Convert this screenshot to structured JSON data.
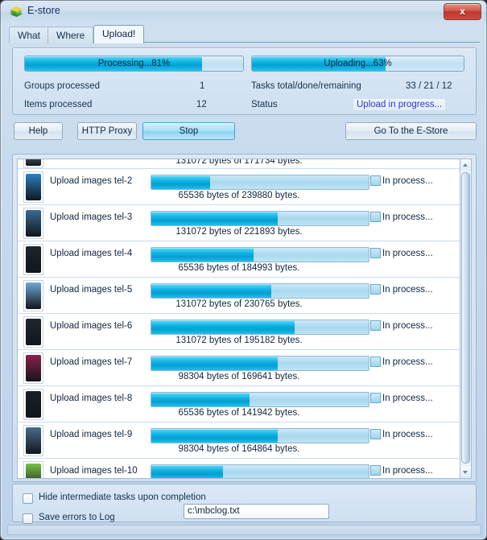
{
  "window": {
    "title": "E-store",
    "icon": "estore-books-icon",
    "close_label": "x"
  },
  "tabs": [
    {
      "label": "What",
      "active": false
    },
    {
      "label": "Where",
      "active": false
    },
    {
      "label": "Upload!",
      "active": true
    }
  ],
  "stats": {
    "processing_bar": {
      "label": "Processing...81%",
      "percent": 81
    },
    "uploading_bar": {
      "label": "Uploading...63%",
      "percent": 63
    },
    "rows": [
      {
        "label": "Groups processed",
        "value": "1"
      },
      {
        "label": "Items processed",
        "value": "12"
      }
    ],
    "tasks_label": "Tasks total/done/remaining",
    "tasks_value": "33 / 21 / 12",
    "status_label": "Status",
    "status_value": "Upload in progress...",
    "status_color": "#2a38d0"
  },
  "buttons": {
    "help": "Help",
    "http_proxy": "HTTP Proxy",
    "stop": "Stop",
    "go_to_store": "Go To the E-Store"
  },
  "tasks": [
    {
      "name": "",
      "percent": 0,
      "state": "",
      "bytes": "131072 bytes of 171734 bytes.",
      "clipped": true,
      "thumb": "#b9c7d3"
    },
    {
      "name": "Upload images tel-2",
      "percent": 27,
      "state": "In process...",
      "bytes": "65536 bytes of 239880 bytes.",
      "clipped": false,
      "thumb": "#2b7fc4"
    },
    {
      "name": "Upload images tel-3",
      "percent": 58,
      "state": "In process...",
      "bytes": "131072 bytes of 221893 bytes.",
      "clipped": false,
      "thumb": "#3b6a92"
    },
    {
      "name": "Upload images tel-4",
      "percent": 47,
      "state": "In process...",
      "bytes": "65536 bytes of 184993 bytes.",
      "clipped": false,
      "thumb": "#1d242c"
    },
    {
      "name": "Upload images tel-5",
      "percent": 55,
      "state": "In process...",
      "bytes": "131072 bytes of 230765 bytes.",
      "clipped": false,
      "thumb": "#6fa8d6"
    },
    {
      "name": "Upload images tel-6",
      "percent": 66,
      "state": "In process...",
      "bytes": "131072 bytes of 195182 bytes.",
      "clipped": false,
      "thumb": "#20262d"
    },
    {
      "name": "Upload images tel-7",
      "percent": 58,
      "state": "In process...",
      "bytes": "98304 bytes of 169641 bytes.",
      "clipped": false,
      "thumb": "#8e1f4a"
    },
    {
      "name": "Upload images tel-8",
      "percent": 45,
      "state": "In process...",
      "bytes": "65536 bytes of 141942 bytes.",
      "clipped": false,
      "thumb": "#1a1f25"
    },
    {
      "name": "Upload images tel-9",
      "percent": 58,
      "state": "In process...",
      "bytes": "98304 bytes of 164864 bytes.",
      "clipped": false,
      "thumb": "#4a6c8c"
    },
    {
      "name": "Upload images tel-10",
      "percent": 33,
      "state": "In process...",
      "bytes": "",
      "clipped": false,
      "thumb": "#79c246"
    }
  ],
  "options": {
    "hide_intermediate": {
      "label": "Hide intermediate tasks upon completion",
      "checked": false
    },
    "save_errors": {
      "label": "Save errors to Log",
      "checked": false
    },
    "log_path": "c:\\mbclog.txt"
  }
}
